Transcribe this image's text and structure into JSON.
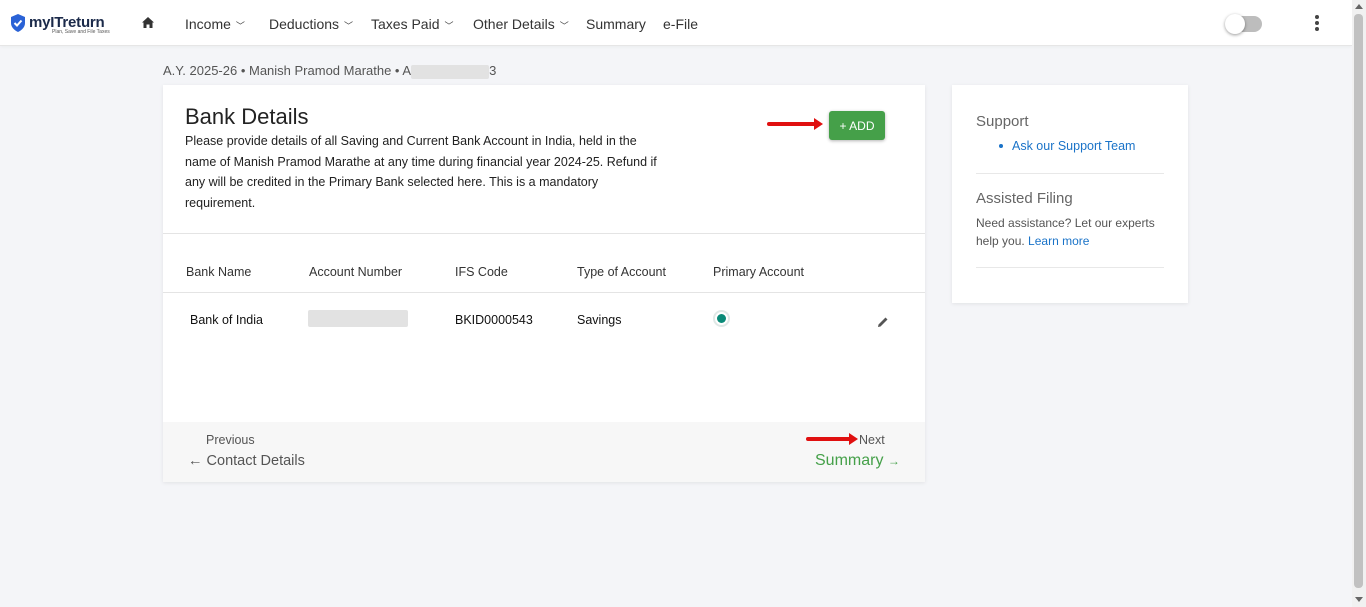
{
  "brand": {
    "name": "myITreturn",
    "tagline": "Plan, Save and File Taxes"
  },
  "nav": {
    "items": [
      {
        "label": "Income",
        "has_dropdown": true
      },
      {
        "label": "Deductions",
        "has_dropdown": true
      },
      {
        "label": "Taxes Paid",
        "has_dropdown": true
      },
      {
        "label": "Other Details",
        "has_dropdown": true
      },
      {
        "label": "Summary",
        "has_dropdown": false
      },
      {
        "label": "e-File",
        "has_dropdown": false
      }
    ],
    "toggle_on": false
  },
  "breadcrumb": {
    "text": "A.Y. 2025-26 • Manish Pramod Marathe • A",
    "tail": "3"
  },
  "bank_details": {
    "title": "Bank Details",
    "description": "Please provide details of all Saving and Current Bank Account in India, held in the name of Manish Pramod Marathe at any time during financial year 2024-25. Refund if any will be credited in the Primary Bank selected here. This is a mandatory requirement.",
    "add_label": "+ ADD",
    "columns": [
      "Bank Name",
      "Account Number",
      "IFS Code",
      "Type of Account",
      "Primary Account"
    ],
    "rows": [
      {
        "bank_name": "Bank of India",
        "account_number": "",
        "ifsc": "BKID0000543",
        "type": "Savings",
        "primary": true
      }
    ]
  },
  "pager": {
    "previous_label": "Previous",
    "previous_link": "Contact Details",
    "next_label": "Next",
    "next_link": "Summary"
  },
  "sidebar": {
    "support_heading": "Support",
    "support_link": "Ask our Support Team",
    "assisted_heading": "Assisted Filing",
    "assisted_text": "Need assistance? Let our experts help you.",
    "learn_more": "Learn more"
  },
  "colors": {
    "accent_green": "#45a049",
    "link_blue": "#1a73c8",
    "radio_teal": "#0a8a78",
    "annotation_red": "#e01010"
  },
  "icons": [
    "home-icon",
    "chevron-down-icon",
    "kebab-menu-icon",
    "edit-pencil-icon",
    "arrow-left-icon",
    "arrow-right-icon",
    "shield-check-icon"
  ]
}
